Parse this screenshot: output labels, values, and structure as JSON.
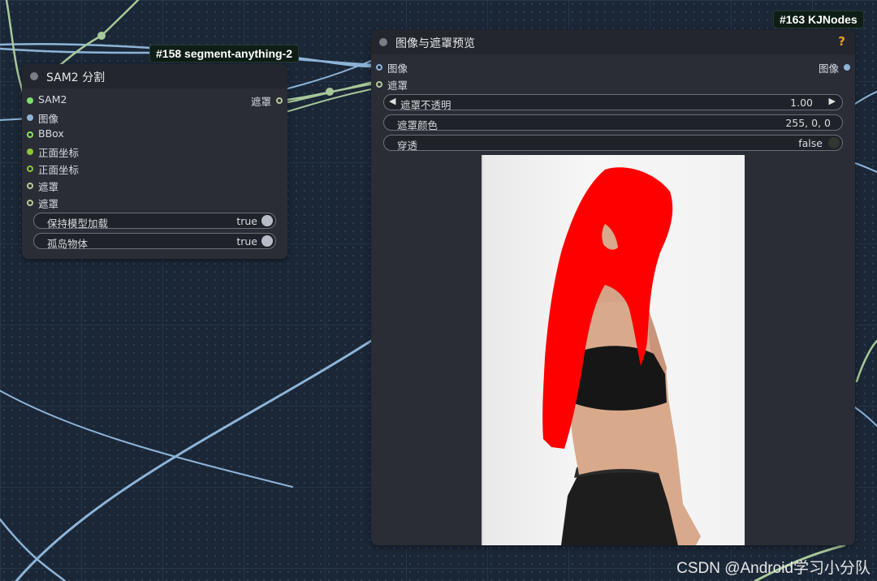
{
  "badges": {
    "sam_badge": "#158 segment-anything-2",
    "kj_badge": "#163 KJNodes"
  },
  "sam_node": {
    "title": "SAM2 分割",
    "inputs": [
      "SAM2",
      "图像",
      "BBox",
      "正面坐标",
      "正面坐标",
      "遮罩",
      "遮罩"
    ],
    "output": "遮罩",
    "widgets": [
      {
        "label": "保持模型加载",
        "value": "true"
      },
      {
        "label": "孤岛物体",
        "value": "true"
      }
    ]
  },
  "preview_node": {
    "title": "图像与遮罩预览",
    "help": "?",
    "inputs": [
      "图像",
      "遮罩"
    ],
    "output": "图像",
    "widgets": [
      {
        "label": "遮罩不透明",
        "value": "1.00"
      },
      {
        "label": "遮罩颜色",
        "value": "255, 0, 0"
      },
      {
        "label": "穿透",
        "value": "false"
      }
    ]
  },
  "watermark": "CSDN @Android学习小分队",
  "colors": {
    "canvas": "#1b2737",
    "node_body": "#2a2d35",
    "node_header": "#23262d",
    "mask": "#ff0000",
    "wire_blue": "#8eb4d8",
    "wire_green": "#a8c89a",
    "help": "#f0a020"
  }
}
